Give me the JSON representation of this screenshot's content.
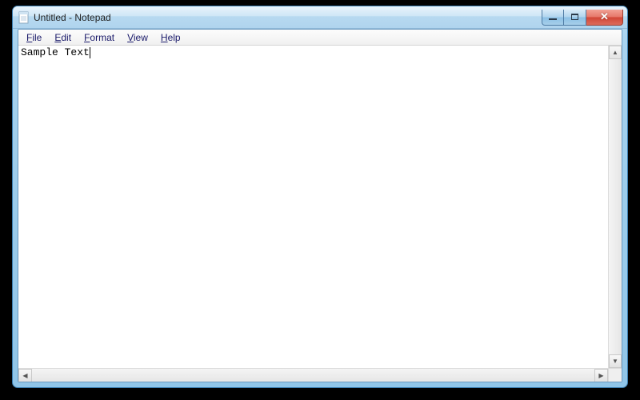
{
  "window": {
    "title": "Untitled - Notepad"
  },
  "menu": {
    "file": "File",
    "edit": "Edit",
    "format": "Format",
    "view": "View",
    "help": "Help"
  },
  "editor": {
    "content": "Sample Text"
  }
}
